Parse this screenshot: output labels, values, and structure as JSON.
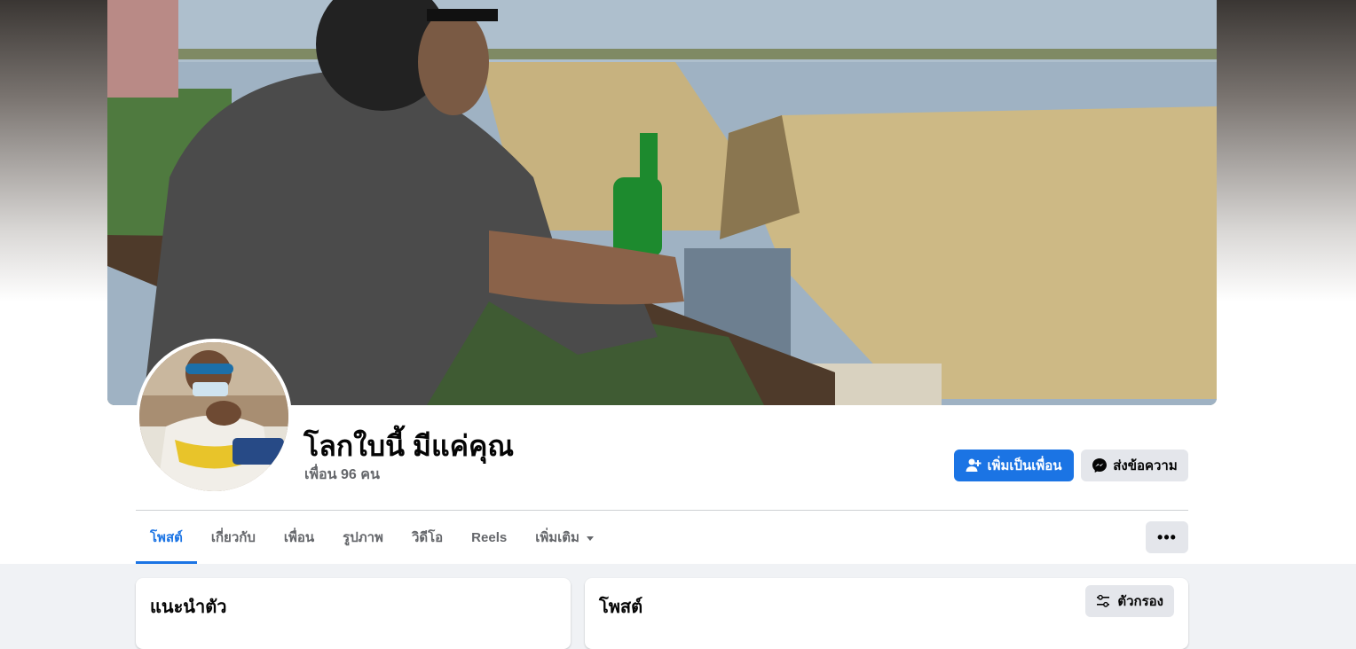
{
  "profile": {
    "name": "โลกใบนี้ มีแค่คุณ",
    "friends": "เพื่อน 96 คน"
  },
  "actions": {
    "add_friend": "เพิ่มเป็นเพื่อน",
    "message": "ส่งข้อความ",
    "more": "•••"
  },
  "tabs": [
    {
      "label": "โพสต์",
      "active": true
    },
    {
      "label": "เกี่ยวกับ"
    },
    {
      "label": "เพื่อน"
    },
    {
      "label": "รูปภาพ"
    },
    {
      "label": "วิดีโอ"
    },
    {
      "label": "Reels"
    },
    {
      "label": "เพิ่มเติม"
    }
  ],
  "intro": {
    "title": "แนะนำตัว"
  },
  "posts": {
    "title": "โพสต์",
    "filter": "ตัวกรอง"
  },
  "colors": {
    "accent": "#1b74e4",
    "secondary_button": "#e4e6eb",
    "muted_text": "#65676b"
  },
  "icons": {
    "add_friend": "person-plus-icon",
    "message": "messenger-icon",
    "filter": "sliders-icon",
    "more_tab": "caret-down-icon"
  }
}
